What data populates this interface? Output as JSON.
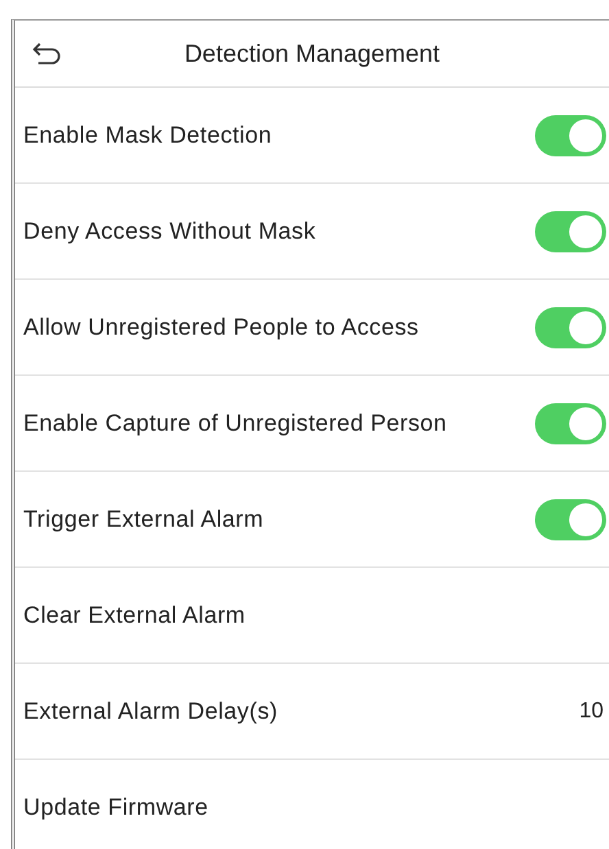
{
  "header": {
    "title": "Detection Management"
  },
  "items": [
    {
      "kind": "toggle",
      "label": "Enable Mask Detection",
      "on": true
    },
    {
      "kind": "toggle",
      "label": "Deny Access Without Mask",
      "on": true
    },
    {
      "kind": "toggle",
      "label": "Allow Unregistered People to Access",
      "on": true
    },
    {
      "kind": "toggle",
      "label": "Enable Capture of Unregistered Person",
      "on": true
    },
    {
      "kind": "toggle",
      "label": "Trigger External Alarm",
      "on": true
    },
    {
      "kind": "plain",
      "label": "Clear External Alarm"
    },
    {
      "kind": "value",
      "label": "External Alarm Delay(s)",
      "value": "10"
    },
    {
      "kind": "plain",
      "label": "Update Firmware"
    }
  ]
}
